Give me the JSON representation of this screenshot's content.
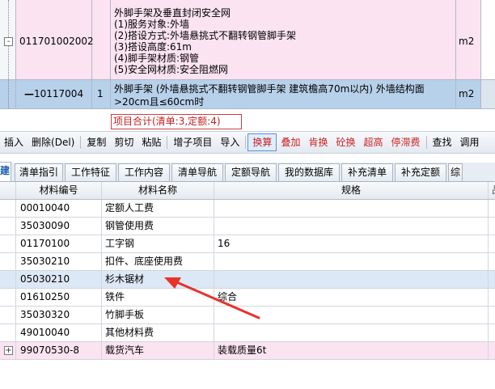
{
  "top_rows": [
    {
      "code": "011701002002",
      "index": "",
      "tree_symbol": "-",
      "description_lines": [
        "外脚手架及垂直封闭安全网",
        "(1)服务对象:外墙",
        "(2)搭设方式:外墙悬挑式不翻转钢管脚手架",
        "(3)搭设高度:61m",
        "(4)脚手架材质:钢管",
        "(5)安全网材质:安全阻燃网"
      ],
      "unit": "m2"
    },
    {
      "code": "10117004",
      "index": "1",
      "tree_symbol": "—",
      "description": "外脚手架 (外墙悬挑式不翻转钢管脚手架 建筑檐高70m以内) 外墙结构面>20cm且≤60cm时",
      "unit": "m2"
    }
  ],
  "summary": "项目合计(清单:3,定额:4)",
  "toolbar": [
    {
      "label": "插入",
      "red": false
    },
    {
      "label": "删除(Del)",
      "red": false
    },
    {
      "sep": true
    },
    {
      "label": "复制",
      "red": false
    },
    {
      "label": "剪切",
      "red": false
    },
    {
      "label": "粘贴",
      "red": false
    },
    {
      "sep": true
    },
    {
      "label": "增子项目",
      "red": false
    },
    {
      "label": "导入",
      "red": false
    },
    {
      "sep": true
    },
    {
      "label": "换算",
      "red": true,
      "active": true
    },
    {
      "label": "叠加",
      "red": true
    },
    {
      "label": "肯换",
      "red": true
    },
    {
      "label": "砼换",
      "red": true
    },
    {
      "label": "超高",
      "red": true
    },
    {
      "label": "停滞费",
      "red": true
    },
    {
      "sep": true
    },
    {
      "label": "查找",
      "red": false
    },
    {
      "label": "调用",
      "red": false
    }
  ],
  "tabs": [
    {
      "label": "建",
      "active": true,
      "width": 14
    },
    {
      "label": "清单指引",
      "width": 60
    },
    {
      "label": "工作特征",
      "width": 64
    },
    {
      "label": "工作内容",
      "width": 64
    },
    {
      "label": "清单导航",
      "width": 64
    },
    {
      "label": "定额导航",
      "width": 64
    },
    {
      "label": "我的数据库",
      "width": 76
    },
    {
      "label": "补充清单",
      "width": 64
    },
    {
      "label": "补充定额",
      "width": 64
    },
    {
      "label": "综",
      "width": 18
    }
  ],
  "materials": {
    "headers": {
      "code": "材料编号",
      "name": "材料名称",
      "spec": "规格",
      "rest": "品"
    },
    "rows": [
      {
        "code": "00010040",
        "name": "定额人工费",
        "spec": "",
        "style": ""
      },
      {
        "code": "35030090",
        "name": "钢管使用费",
        "spec": "",
        "style": ""
      },
      {
        "code": "01170100",
        "name": "工字钢",
        "spec": "16",
        "style": ""
      },
      {
        "code": "35030210",
        "name": "扣件、底座使用费",
        "spec": "",
        "style": ""
      },
      {
        "code": "05030210",
        "name": "杉木锯材",
        "spec": "",
        "style": "selected"
      },
      {
        "code": "01610250",
        "name": "铁件",
        "spec": "综合",
        "style": ""
      },
      {
        "code": "35030320",
        "name": "竹脚手板",
        "spec": "",
        "style": ""
      },
      {
        "code": "49010040",
        "name": "其他材料费",
        "spec": "",
        "style": ""
      },
      {
        "code": "99070530-8",
        "name": "载货汽车",
        "spec": "装载质量6t",
        "style": "pink",
        "tree": "+"
      }
    ]
  },
  "colors": {
    "annotation_arrow": "#e8322c",
    "accent_red": "#cc2222"
  }
}
